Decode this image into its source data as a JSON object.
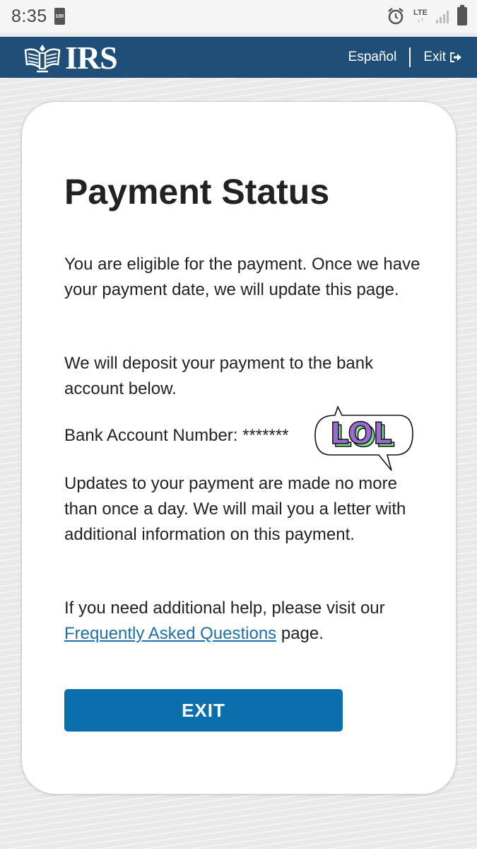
{
  "status_bar": {
    "time": "8:35",
    "battery_small_label": "100",
    "network": "LTE"
  },
  "header": {
    "logo_text": "IRS",
    "language_link": "Español",
    "exit_link": "Exit"
  },
  "card": {
    "title": "Payment Status",
    "para1": "You are eligible for the payment. Once we have your payment date, we will update this page.",
    "para2": "We will deposit your payment to the bank account below.",
    "bank_label": "Bank Account Number: *******",
    "para4": "Updates to your payment are made no more than once a day. We will mail you a letter with additional information on this payment.",
    "help_text_before": "If you need additional help, please visit our ",
    "faq_link": "Frequently Asked Questions",
    "help_text_after": " page.",
    "exit_button": "EXIT"
  },
  "sticker": {
    "text": "LOL",
    "fill_color": "#9b6bd6",
    "shadow_color": "#7de08a"
  },
  "colors": {
    "header_bg": "#1f4e79",
    "button_bg": "#0b6fae",
    "link": "#1f6fa8"
  }
}
